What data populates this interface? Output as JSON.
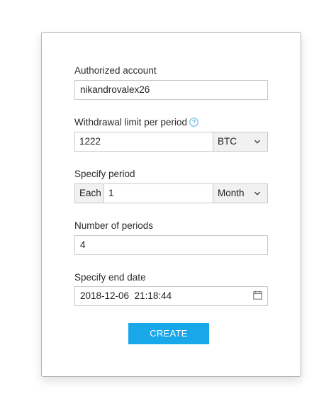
{
  "form": {
    "account_label": "Authorized account",
    "account_value": "nikandrovalex26",
    "limit_label": "Withdrawal limit per period",
    "help_icon": "question-circle-icon",
    "limit_value": "1222",
    "currency_selected": "BTC",
    "period_label": "Specify period",
    "period_prefix": "Each",
    "period_value": "1",
    "period_unit_selected": "Month",
    "num_periods_label": "Number of periods",
    "num_periods_value": "4",
    "end_date_label": "Specify end date",
    "end_date_value": "2018-12-06  21:18:44",
    "calendar_icon": "calendar-icon",
    "create_label": "CREATE"
  },
  "colors": {
    "accent": "#18a7e8",
    "border": "#c9c9c9",
    "text": "#2b2b2b"
  }
}
